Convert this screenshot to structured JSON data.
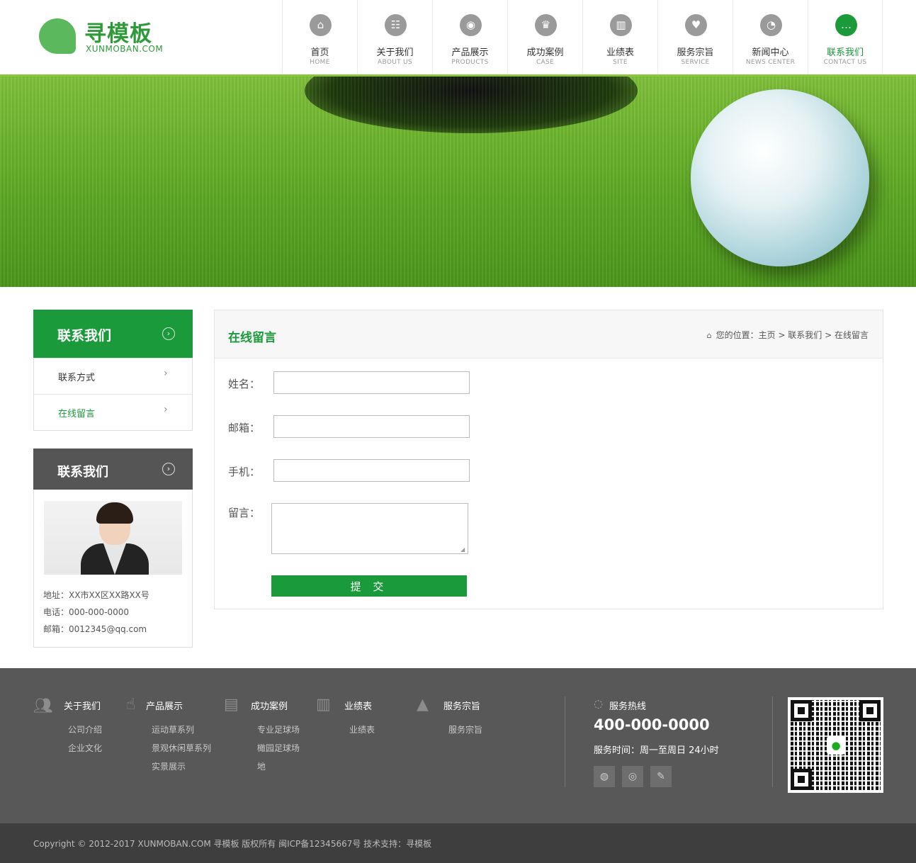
{
  "brand": {
    "name": "寻模板",
    "domain": "XUNMOBAN.COM"
  },
  "nav": [
    {
      "cn": "首页",
      "en": "HOME",
      "icon": "bank-icon",
      "glyph": "⌂"
    },
    {
      "cn": "关于我们",
      "en": "ABOUT US",
      "icon": "team-icon",
      "glyph": "☷"
    },
    {
      "cn": "产品展示",
      "en": "PRODUCTS",
      "icon": "eye-icon",
      "glyph": "◉"
    },
    {
      "cn": "成功案例",
      "en": "CASE",
      "icon": "crown-icon",
      "glyph": "♛"
    },
    {
      "cn": "业绩表",
      "en": "SITE",
      "icon": "bar-chart-icon",
      "glyph": "▥"
    },
    {
      "cn": "服务宗旨",
      "en": "SERVICE",
      "icon": "heart-hand-icon",
      "glyph": "♥"
    },
    {
      "cn": "新闻中心",
      "en": "NEWS CENTER",
      "icon": "rss-icon",
      "glyph": "◔"
    },
    {
      "cn": "联系我们",
      "en": "CONTACT US",
      "icon": "chat-icon",
      "glyph": "…",
      "active": true
    }
  ],
  "sidebar": {
    "menu_title": "联系我们",
    "items": [
      {
        "label": "联系方式"
      },
      {
        "label": "在线留言",
        "active": true
      }
    ],
    "contact_title": "联系我们",
    "address": "地址：XX市XX区XX路XX号",
    "phone": "电话：000-000-0000",
    "email": "邮箱：0012345@qq.com"
  },
  "main": {
    "title": "在线留言",
    "breadcrumb": "您的位置：主页 > 联系我们 > 在线留言",
    "form": {
      "name_label": "姓名：",
      "email_label": "邮箱：",
      "phone_label": "手机：",
      "message_label": "留言：",
      "name_value": "",
      "email_value": "",
      "phone_value": "",
      "message_value": "",
      "submit_label": "提 交"
    }
  },
  "footer": {
    "columns": [
      {
        "title": "关于我们",
        "icon": "users-icon",
        "links": [
          "公司介绍",
          "企业文化"
        ]
      },
      {
        "title": "产品展示",
        "icon": "pointer-hand-icon",
        "links": [
          "运动草系列",
          "景观休闲草系列",
          "实景展示"
        ]
      },
      {
        "title": "成功案例",
        "icon": "newspaper-icon",
        "links": [
          "专业足球场",
          "橄园足球场",
          "地"
        ]
      },
      {
        "title": "业绩表",
        "icon": "books-icon",
        "links": [
          "业绩表"
        ]
      },
      {
        "title": "服务宗旨",
        "icon": "tree-icon",
        "links": [
          "服务宗旨"
        ]
      }
    ],
    "hotline_title": "服务热线",
    "hotline_number": "400-000-0000",
    "service_time": "服务时间：周一至周日 24小时",
    "socials": [
      "wechat-icon",
      "weibo-icon",
      "tencent-weibo-icon"
    ],
    "copyright": "Copyright © 2012-2017 XUNMOBAN.COM 寻模板 版权所有 闽ICP备12345667号 技术支持：寻模板"
  },
  "colors": {
    "brand_green": "#1a9a3a",
    "accent_green": "#8cc63f",
    "footer_bg": "#585858",
    "copyright_bg": "#3e3e3e"
  }
}
